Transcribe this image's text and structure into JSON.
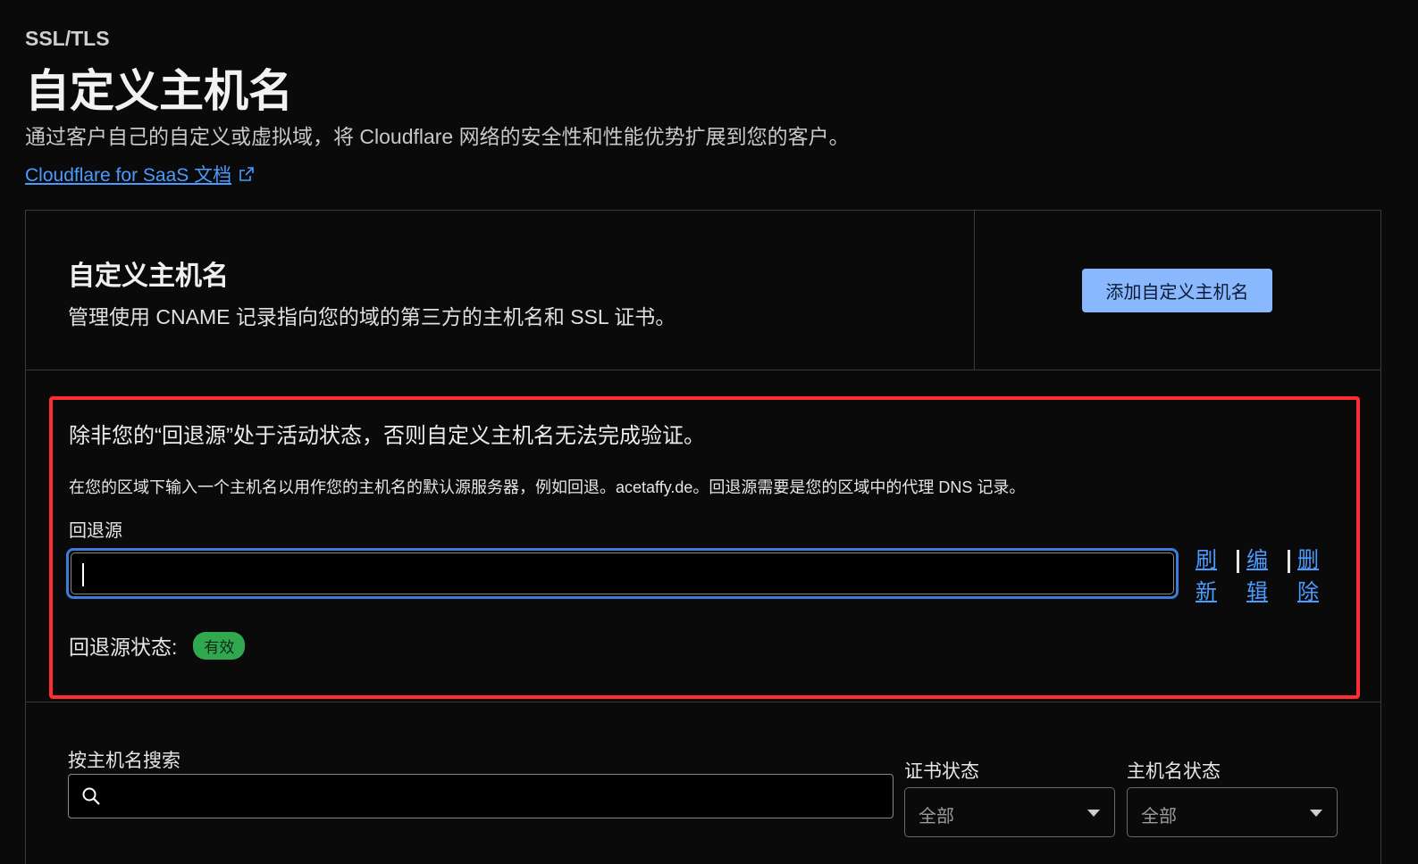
{
  "header": {
    "breadcrumb": "SSL/TLS",
    "title": "自定义主机名",
    "description": "通过客户自己的自定义或虚拟域，将 Cloudflare 网络的安全性和性能优势扩展到您的客户。",
    "doc_link": "Cloudflare for SaaS 文档"
  },
  "card": {
    "title": "自定义主机名",
    "description": "管理使用 CNAME 记录指向您的域的第三方的主机名和 SSL 证书。",
    "add_button": "添加自定义主机名"
  },
  "fallback": {
    "warning": "除非您的“回退源”处于活动状态，否则自定义主机名无法完成验证。",
    "help": "在您的区域下输入一个主机名以用作您的主机名的默认源服务器，例如回退。acetaffy.de。回退源需要是您的区域中的代理 DNS 记录。",
    "label": "回退源",
    "input_value": "",
    "actions": {
      "refresh": "刷新",
      "edit": "编辑",
      "delete": "删除"
    },
    "status_label": "回退源状态:",
    "status_value": "有效",
    "status_color": "#2fa84f"
  },
  "filters": {
    "search_label": "按主机名搜索",
    "search_placeholder": "",
    "cert_status_label": "证书状态",
    "cert_status_value": "全部",
    "hostname_status_label": "主机名状态",
    "hostname_status_value": "全部"
  },
  "colors": {
    "accent": "#8ab8ff",
    "link": "#4b9bff",
    "highlight_border": "#ff2d2d",
    "background": "#0a0a0a"
  }
}
